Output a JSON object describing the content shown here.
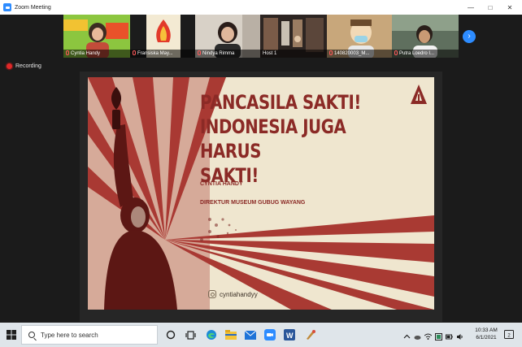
{
  "window": {
    "title": "Zoom Meeting"
  },
  "participants": [
    {
      "name": "Cyntia Handy",
      "bg": "#7dbb2a",
      "muted": true
    },
    {
      "name": "Fransiska May...",
      "bg": "#efe3c8",
      "muted": true
    },
    {
      "name": "Nindya Rimma",
      "bg": "#cfc7bd",
      "muted": true
    },
    {
      "name": "Host 1",
      "bg": "#2a2220",
      "muted": false
    },
    {
      "name": "140820003_M...",
      "bg": "#c9a97a",
      "muted": true
    },
    {
      "name": "Putra Loedro I...",
      "bg": "#6c7a6a",
      "muted": true
    }
  ],
  "recording": {
    "label": "Recording"
  },
  "slide": {
    "title_lines": [
      "PANCASILA SAKTI!",
      "INDONESIA JUGA HARUS",
      "SAKTI!"
    ],
    "presenter_name": "CYNTIA HANDY",
    "presenter_role": "DIREKTUR MUSEUM GUBUG WAYANG",
    "handle": "cyntiahandyy",
    "colors": {
      "red": "#a93a33",
      "cream": "#efe6cf",
      "text": "#8b2a26"
    }
  },
  "taskbar": {
    "search_placeholder": "Type here to search",
    "time": "10:33 AM",
    "date": "6/1/2021",
    "notifications": "2"
  },
  "icons": [
    "windows-start-icon",
    "search-icon",
    "cortana-icon",
    "task-view-icon",
    "edge-icon",
    "file-explorer-icon",
    "mail-icon",
    "zoom-icon",
    "word-icon",
    "paint-icon",
    "chevron-right-icon",
    "instagram-icon"
  ]
}
